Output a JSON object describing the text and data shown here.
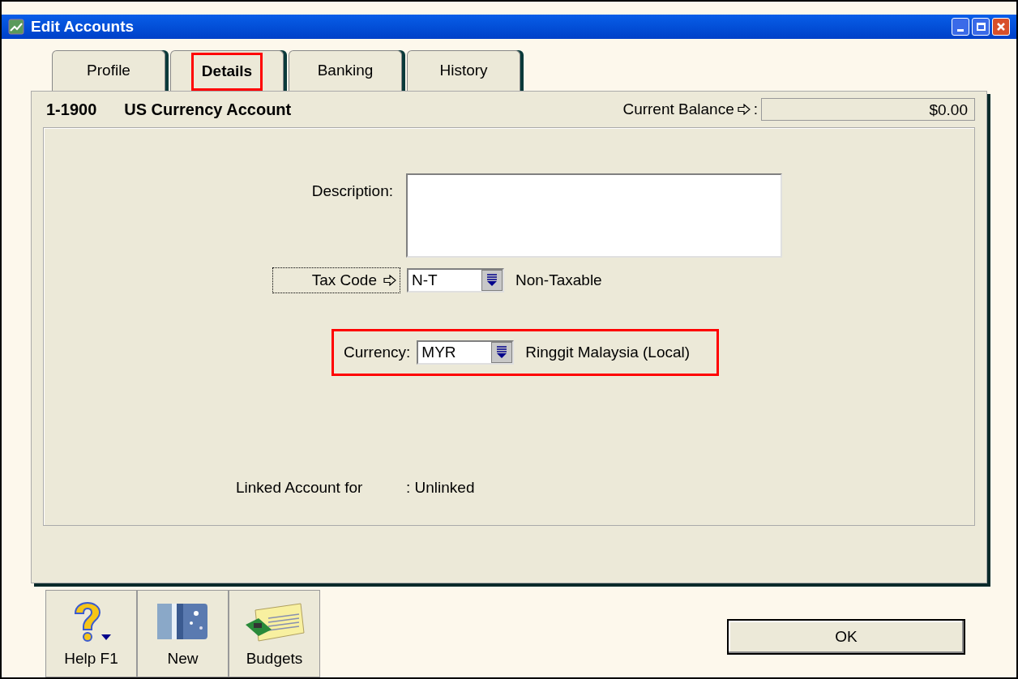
{
  "window": {
    "title": "Edit Accounts"
  },
  "tabs": [
    {
      "label": "Profile",
      "selected": false,
      "highlighted": false
    },
    {
      "label": "Details",
      "selected": true,
      "highlighted": true
    },
    {
      "label": "Banking",
      "selected": false,
      "highlighted": false
    },
    {
      "label": "History",
      "selected": false,
      "highlighted": false
    }
  ],
  "account": {
    "number": "1-1900",
    "name": "US Currency Account",
    "balance_label": "Current Balance",
    "balance_colon": ":",
    "balance": "$0.00"
  },
  "description": {
    "label": "Description:"
  },
  "tax_code": {
    "label": "Tax Code",
    "value": "N-T",
    "text": "Non-Taxable"
  },
  "currency": {
    "label": "Currency:",
    "value": "MYR",
    "text": "Ringgit Malaysia (Local)",
    "highlighted": true
  },
  "linked": {
    "label": "Linked Account for",
    "value": ": Unlinked"
  },
  "toolbar": [
    {
      "kind": "help",
      "label": "Help F1"
    },
    {
      "kind": "new",
      "label": "New"
    },
    {
      "kind": "budgets",
      "label": "Budgets"
    }
  ],
  "ok_button": "OK"
}
